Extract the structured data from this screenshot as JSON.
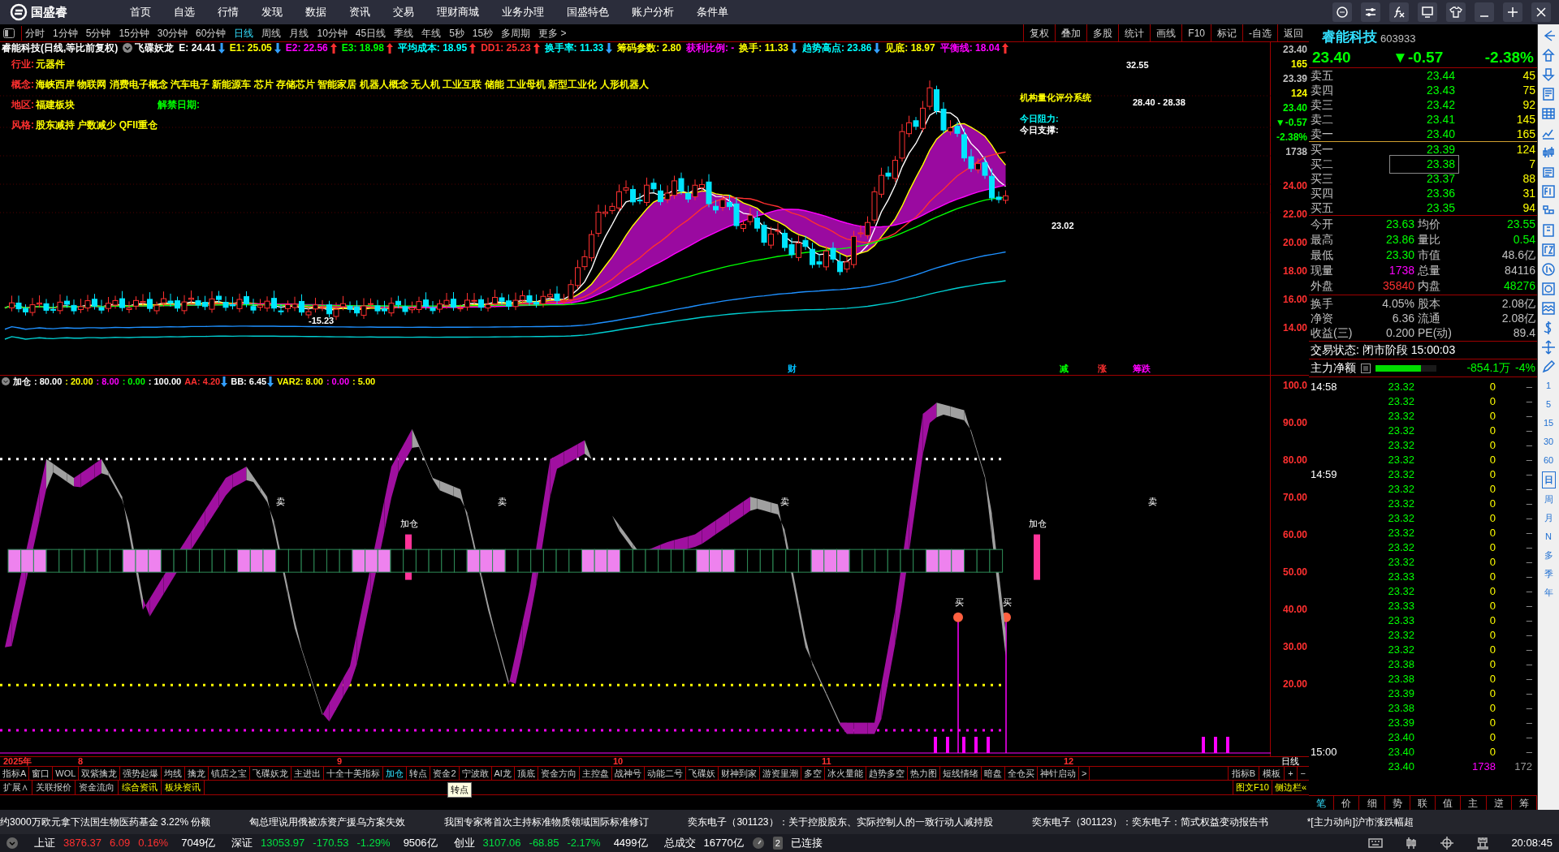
{
  "app": {
    "name": "国盛睿"
  },
  "main_menu": [
    "首页",
    "自选",
    "行情",
    "发现",
    "数据",
    "资讯",
    "交易",
    "理财商城",
    "业务办理",
    "国盛特色",
    "账户分析",
    "条件单"
  ],
  "periods": [
    {
      "label": "分时",
      "selected": false
    },
    {
      "label": "1分钟",
      "selected": false
    },
    {
      "label": "5分钟",
      "selected": false
    },
    {
      "label": "15分钟",
      "selected": false
    },
    {
      "label": "30分钟",
      "selected": false
    },
    {
      "label": "60分钟",
      "selected": false
    },
    {
      "label": "日线",
      "selected": true
    },
    {
      "label": "周线",
      "selected": false
    },
    {
      "label": "月线",
      "selected": false
    },
    {
      "label": "10分钟",
      "selected": false
    },
    {
      "label": "45日线",
      "selected": false
    },
    {
      "label": "季线",
      "selected": false
    },
    {
      "label": "年线",
      "selected": false
    },
    {
      "label": "5秒",
      "selected": false
    },
    {
      "label": "15秒",
      "selected": false
    },
    {
      "label": "多周期",
      "selected": false
    },
    {
      "label": "更多 >",
      "selected": false
    }
  ],
  "chart_toolbar": [
    "复权",
    "叠加",
    "多股",
    "统计",
    "画线",
    "F10",
    "标记",
    "-自选",
    "返回"
  ],
  "chart_header": {
    "title": "睿能科技(日线,等比前复权)",
    "indicator": "飞碟妖龙",
    "values": [
      {
        "text": "E: 24.41",
        "color": "#ffffff",
        "arrow": {
          "kind": "down",
          "color": "#33a0ff"
        }
      },
      {
        "text": "E1: 25.05",
        "color": "#ffff00",
        "arrow": {
          "kind": "down",
          "color": "#33a0ff"
        }
      },
      {
        "text": "E2: 22.56",
        "color": "#ff00ff",
        "arrow": {
          "kind": "up",
          "color": "#ff3030"
        }
      },
      {
        "text": "E3: 18.98",
        "color": "#00ff00",
        "arrow": {
          "kind": "up",
          "color": "#ff3030"
        }
      },
      {
        "text": "平均成本: 18.95",
        "color": "#00ffff",
        "arrow": {
          "kind": "up",
          "color": "#ff3030"
        }
      },
      {
        "text": "DD1: 25.23",
        "color": "#ff3030",
        "arrow": {
          "kind": "up",
          "color": "#ff3030"
        }
      },
      {
        "text": "换手率: 11.33",
        "color": "#00ffff",
        "arrow": {
          "kind": "down",
          "color": "#33a0ff"
        }
      },
      {
        "text": "筹码参数: 2.80",
        "color": "#ffff00"
      },
      {
        "text": "获利比例: -",
        "color": "#ff00ff"
      },
      {
        "text": "换手: 11.33",
        "color": "#ffff00",
        "arrow": {
          "kind": "down",
          "color": "#33a0ff"
        }
      },
      {
        "text": "趋势高点: 23.86",
        "color": "#00ffff",
        "arrow": {
          "kind": "down",
          "color": "#33a0ff"
        }
      },
      {
        "text": "见底: 18.97",
        "color": "#ffff00"
      },
      {
        "text": "平衡线: 18.04",
        "color": "#ff00ff",
        "arrow": {
          "kind": "up",
          "color": "#ff3030"
        }
      }
    ]
  },
  "info_lines": [
    {
      "label": "行业:",
      "text": "元器件"
    },
    {
      "label": "概念:",
      "text": "海峡西岸 物联网 消费电子概念 汽车电子 新能源车 芯片 存储芯片 智能家居 机器人概念 无人机 工业互联 储能 工业母机 新型工业化 人形机器人"
    },
    {
      "label": "地区:",
      "text": "福建板块",
      "extra": "解禁日期:"
    },
    {
      "label": "风格:",
      "text": "股东减持 户数减少 QFII重仓"
    }
  ],
  "chart_annotations": [
    "-15.23",
    "23.02",
    "32.55",
    "28.40 - 28.38",
    "机构量化评分系统",
    "今日阻力:",
    "今日支撑:"
  ],
  "chart_markers": [
    "财",
    "减",
    "涨",
    "筹跌"
  ],
  "price_axis": {
    "quote": [
      {
        "text": "23.40",
        "color": "#c0c0c0"
      },
      {
        "text": "165",
        "color": "#ffff00"
      },
      {
        "text": "23.39",
        "color": "#c0c0c0"
      },
      {
        "text": "124",
        "color": "#ffff00"
      },
      {
        "text": "23.40",
        "color": "#00ff00"
      },
      {
        "text": "▼-0.57",
        "color": "#00ff00"
      },
      {
        "text": "-2.38%",
        "color": "#00ff00"
      },
      {
        "text": "1738",
        "color": "#c0c0c0"
      }
    ],
    "scale": [
      "24.00",
      "22.00",
      "20.00",
      "18.00",
      "16.00",
      "14.00"
    ]
  },
  "indicator_header": {
    "name": "加仓",
    "values": [
      {
        "text": ": 80.00",
        "color": "#ffffff"
      },
      {
        "text": ": 20.00",
        "color": "#ffff00"
      },
      {
        "text": ": 8.00",
        "color": "#ff00ff"
      },
      {
        "text": ": 0.00",
        "color": "#00ff00"
      },
      {
        "text": ": 100.00",
        "color": "#ffffff"
      },
      {
        "text": "AA: 4.20",
        "color": "#ff3030",
        "arrow": {
          "kind": "down",
          "color": "#33a0ff"
        }
      },
      {
        "text": "BB: 6.45",
        "color": "#ffffff",
        "arrow": {
          "kind": "down",
          "color": "#33a0ff"
        }
      },
      {
        "text": "VAR2: 8.00",
        "color": "#ffff00"
      },
      {
        "text": ": 0.00",
        "color": "#ff00ff"
      },
      {
        "text": ": 5.00",
        "color": "#ffff00"
      }
    ]
  },
  "indicator_labels": [
    "加仓",
    "加仓",
    "卖",
    "卖",
    "卖",
    "卖",
    "买",
    "买"
  ],
  "indicator_axis": [
    "100.0",
    "90.00",
    "80.00",
    "70.00",
    "60.00",
    "50.00",
    "40.00",
    "30.00",
    "20.00"
  ],
  "x_axis": [
    "2025年",
    "8",
    "9",
    "10",
    "11",
    "12"
  ],
  "x_axis_period": "日线",
  "quote": {
    "name": "睿能科技",
    "code": "603933",
    "price": "23.40",
    "change": "▼-0.57",
    "percent": "-2.38%",
    "asks": [
      {
        "label": "卖五",
        "price": "23.44",
        "volume": "45",
        "selected": false
      },
      {
        "label": "卖四",
        "price": "23.43",
        "volume": "75",
        "selected": false
      },
      {
        "label": "卖三",
        "price": "23.42",
        "volume": "92",
        "selected": false
      },
      {
        "label": "卖二",
        "price": "23.41",
        "volume": "145",
        "selected": false
      },
      {
        "label": "卖一",
        "price": "23.40",
        "volume": "165",
        "selected": false
      }
    ],
    "bids": [
      {
        "label": "买一",
        "price": "23.39",
        "volume": "124",
        "selected": false
      },
      {
        "label": "买二",
        "price": "23.38",
        "volume": "7",
        "selected": true
      },
      {
        "label": "买三",
        "price": "23.37",
        "volume": "88",
        "selected": false
      },
      {
        "label": "买四",
        "price": "23.36",
        "volume": "31",
        "selected": false
      },
      {
        "label": "买五",
        "price": "23.35",
        "volume": "94",
        "selected": false
      }
    ],
    "stats": [
      {
        "left": {
          "label": "今开",
          "value": "23.63",
          "color": "#00ff00"
        },
        "right": {
          "label": "均价",
          "value": "23.55",
          "color": "#00ff00"
        }
      },
      {
        "left": {
          "label": "最高",
          "value": "23.86",
          "color": "#00ff00"
        },
        "right": {
          "label": "量比",
          "value": "0.54",
          "color": "#00ff00"
        }
      },
      {
        "left": {
          "label": "最低",
          "value": "23.30",
          "color": "#00ff00"
        },
        "right": {
          "label": "市值",
          "value": "48.6亿",
          "color": "#c0c0c0"
        }
      },
      {
        "left": {
          "label": "现量",
          "value": "1738",
          "color": "#ff00ff"
        },
        "right": {
          "label": "总量",
          "value": "84116",
          "color": "#c0c0c0"
        }
      },
      {
        "left": {
          "label": "外盘",
          "value": "35840",
          "color": "#ff3030"
        },
        "right": {
          "label": "内盘",
          "value": "48276",
          "color": "#00ff00"
        }
      }
    ],
    "stats2": [
      {
        "label": "换手",
        "value": "4.05%",
        "label2": "股本",
        "value2": "2.08亿"
      },
      {
        "label": "净资",
        "value": "6.36",
        "label2": "流通",
        "value2": "2.08亿"
      },
      {
        "label": "收益(三)",
        "value": "0.200",
        "label2": "PE(动)",
        "value2": "89.4"
      }
    ],
    "trade_status": "交易状态: 闭市阶段 15:00:03",
    "main_flow": {
      "label": "主力净额",
      "level": 0.75,
      "value": "-854.1万",
      "percent": "-4%"
    }
  },
  "ticks": [
    {
      "time": "14:58",
      "price": "23.32",
      "volume": "0",
      "mark": "–"
    },
    {
      "price": "23.32",
      "volume": "0",
      "mark": "–"
    },
    {
      "price": "23.32",
      "volume": "0",
      "mark": "–"
    },
    {
      "price": "23.32",
      "volume": "0",
      "mark": "–"
    },
    {
      "price": "23.32",
      "volume": "0",
      "mark": "–"
    },
    {
      "price": "23.32",
      "volume": "0",
      "mark": "–"
    },
    {
      "time": "14:59",
      "price": "23.32",
      "volume": "0",
      "mark": "–"
    },
    {
      "price": "23.32",
      "volume": "0",
      "mark": "–"
    },
    {
      "price": "23.32",
      "volume": "0",
      "mark": "–"
    },
    {
      "price": "23.32",
      "volume": "0",
      "mark": "–"
    },
    {
      "price": "23.32",
      "volume": "0",
      "mark": "–"
    },
    {
      "price": "23.32",
      "volume": "0",
      "mark": "–"
    },
    {
      "price": "23.32",
      "volume": "0",
      "mark": "–"
    },
    {
      "price": "23.33",
      "volume": "0",
      "mark": "–"
    },
    {
      "price": "23.32",
      "volume": "0",
      "mark": "–"
    },
    {
      "price": "23.33",
      "volume": "0",
      "mark": "–"
    },
    {
      "price": "23.33",
      "volume": "0",
      "mark": "–"
    },
    {
      "price": "23.32",
      "volume": "0",
      "mark": "–"
    },
    {
      "price": "23.32",
      "volume": "0",
      "mark": "–"
    },
    {
      "price": "23.38",
      "volume": "0",
      "mark": "–"
    },
    {
      "price": "23.38",
      "volume": "0",
      "mark": "–"
    },
    {
      "price": "23.39",
      "volume": "0",
      "mark": "–"
    },
    {
      "price": "23.38",
      "volume": "0",
      "mark": "–"
    },
    {
      "price": "23.39",
      "volume": "0",
      "mark": "–"
    },
    {
      "price": "23.40",
      "volume": "0",
      "mark": "–"
    },
    {
      "time": "15:00",
      "price": "23.40",
      "volume": "0",
      "mark": "–"
    },
    {
      "price": "23.40",
      "volume": "1738",
      "mark": "172",
      "kind": "summary"
    }
  ],
  "panel_tabs": [
    {
      "label": "笔",
      "selected": true
    },
    {
      "label": "价",
      "selected": false
    },
    {
      "label": "细",
      "selected": false
    },
    {
      "label": "势",
      "selected": false
    },
    {
      "label": "联",
      "selected": false
    },
    {
      "label": "值",
      "selected": false
    },
    {
      "label": "主",
      "selected": false
    },
    {
      "label": "逆",
      "selected": false
    },
    {
      "label": "筹",
      "selected": false
    }
  ],
  "side_periods": [
    {
      "label": "1",
      "selected": false
    },
    {
      "label": "5",
      "selected": false
    },
    {
      "label": "15",
      "selected": false
    },
    {
      "label": "30",
      "selected": false
    },
    {
      "label": "60",
      "selected": false
    },
    {
      "label": "日",
      "selected": true
    },
    {
      "label": "周",
      "selected": false
    },
    {
      "label": "月",
      "selected": false
    },
    {
      "label": "N",
      "selected": false
    },
    {
      "label": "多",
      "selected": false
    },
    {
      "label": "季",
      "selected": false
    },
    {
      "label": "年",
      "selected": false
    }
  ],
  "indicator_tabs": [
    {
      "label": "指标A",
      "selected": false
    },
    {
      "label": "窗口",
      "selected": false
    },
    {
      "label": "WOL",
      "selected": false
    },
    {
      "label": "双紫擒龙",
      "selected": false
    },
    {
      "label": "强势起爆",
      "selected": false
    },
    {
      "label": "均线",
      "selected": false
    },
    {
      "label": "擒龙",
      "selected": false
    },
    {
      "label": "镇店之宝",
      "selected": false
    },
    {
      "label": "飞碟妖龙",
      "selected": false
    },
    {
      "label": "主进出",
      "selected": false
    },
    {
      "label": "十全十美指标",
      "selected": false
    },
    {
      "label": "加仓",
      "selected": true
    },
    {
      "label": "转点",
      "selected": false
    },
    {
      "label": "资金2",
      "selected": false
    },
    {
      "label": "宁波敢",
      "selected": false
    },
    {
      "label": "AI龙",
      "selected": false
    },
    {
      "label": "顶底",
      "selected": false
    },
    {
      "label": "资金方向",
      "selected": false
    },
    {
      "label": "主控盘",
      "selected": false
    },
    {
      "label": "战神号",
      "selected": false
    },
    {
      "label": "动能二号",
      "selected": false
    },
    {
      "label": "飞碟妖",
      "selected": false
    },
    {
      "label": "财神到家",
      "selected": false
    },
    {
      "label": "游资里潮",
      "selected": false
    },
    {
      "label": "多空",
      "selected": false
    },
    {
      "label": "冰火量能",
      "selected": false
    },
    {
      "label": "趋势多空",
      "selected": false
    },
    {
      "label": "热力图",
      "selected": false
    },
    {
      "label": "短线情绪",
      "selected": false
    },
    {
      "label": "暗盘",
      "selected": false
    },
    {
      "label": "全仓买",
      "selected": false
    },
    {
      "label": "神针启动",
      "selected": false
    },
    {
      "label": ">",
      "selected": false
    }
  ],
  "indicator_tabs_right": [
    "指标B",
    "模板",
    "+",
    "−"
  ],
  "tooltip": "转点",
  "info_tabs": [
    {
      "label": "扩展∧",
      "highlight": false
    },
    {
      "label": "关联报价",
      "highlight": false
    },
    {
      "label": "资金流向",
      "highlight": false
    },
    {
      "label": "综合资讯",
      "highlight": true
    },
    {
      "label": "板块资讯",
      "highlight": true
    }
  ],
  "info_tabs_right": [
    "图文F10",
    "侧边栏«"
  ],
  "news": [
    "约3000万欧元拿下法国生物医药基金 3.22% 份额",
    "匈总理说用俄被冻资产援乌方案失效",
    "我国专家将首次主持标准物质领域国际标准修订",
    "奕东电子（301123）：关于控股股东、实际控制人的一致行动人减持股",
    "奕东电子（301123）：奕东电子：简式权益变动报告书",
    "*[主力动向]沪市涨跌幅超"
  ],
  "indices": [
    {
      "name": "上证",
      "value": "3876.37",
      "change": "6.09",
      "percent": "0.16%",
      "amount": "7049亿",
      "color": "#ff3030"
    },
    {
      "name": "深证",
      "value": "13053.97",
      "change": "-170.53",
      "percent": "-1.29%",
      "amount": "9506亿",
      "color": "#00e040"
    },
    {
      "name": "创业",
      "value": "3107.06",
      "change": "-68.85",
      "percent": "-2.17%",
      "amount": "4499亿",
      "color": "#00e040"
    }
  ],
  "total_turnover": {
    "label": "总成交",
    "value": "16770亿"
  },
  "connection": {
    "count": "2",
    "label": "已连接"
  },
  "clock": "20:08:45"
}
